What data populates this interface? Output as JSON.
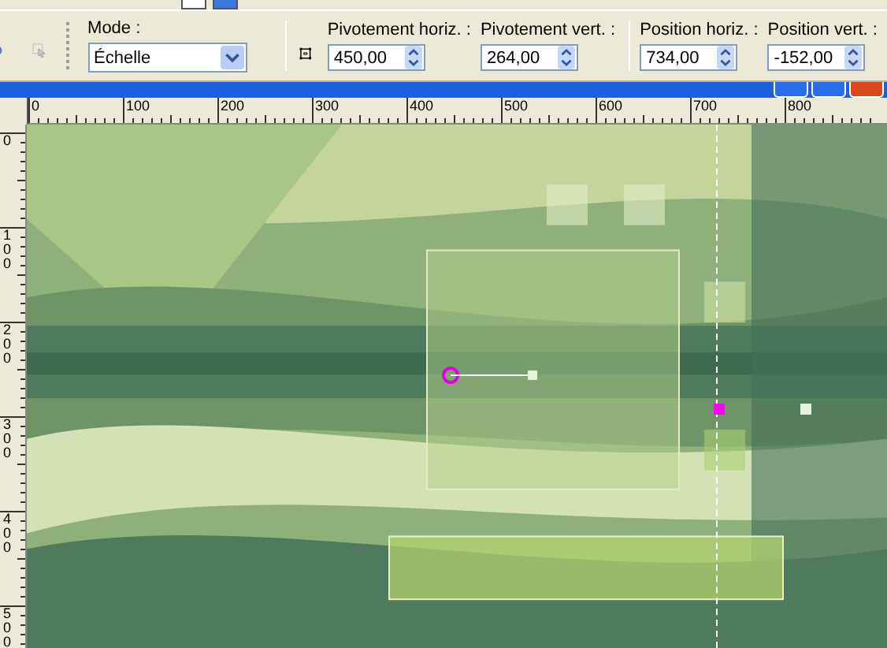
{
  "toolbar": {
    "mode": {
      "label": "Mode :",
      "value": "Échelle"
    },
    "fields": [
      {
        "label": "Pivotement horiz. :",
        "value": "450,00"
      },
      {
        "label": "Pivotement vert. :",
        "value": "264,00"
      },
      {
        "label": "Position horiz. :",
        "value": "734,00"
      },
      {
        "label": "Position vert. :",
        "value": "-152,00"
      }
    ]
  },
  "rulers": {
    "horizontal": [
      "0",
      "100",
      "200",
      "300",
      "400",
      "500",
      "600",
      "700",
      "800"
    ],
    "vertical": [
      "0",
      "100",
      "200",
      "300",
      "400",
      "500"
    ]
  }
}
